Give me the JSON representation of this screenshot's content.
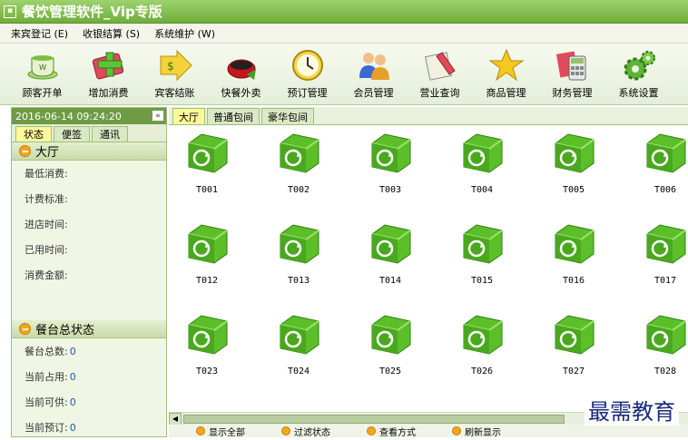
{
  "window": {
    "title": "餐饮管理软件_Vip专版"
  },
  "menu": [
    {
      "label": "来宾登记 (E)"
    },
    {
      "label": "收银结算 (S)"
    },
    {
      "label": "系统维护 (W)"
    }
  ],
  "toolbar": [
    {
      "label": "顾客开单",
      "icon": "teacup-icon"
    },
    {
      "label": "增加消费",
      "icon": "add-consumption-icon"
    },
    {
      "label": "宾客结账",
      "icon": "checkout-arrow-icon"
    },
    {
      "label": "快餐外卖",
      "icon": "takeaway-icon"
    },
    {
      "label": "预订管理",
      "icon": "clock-icon"
    },
    {
      "label": "会员管理",
      "icon": "members-icon"
    },
    {
      "label": "营业查询",
      "icon": "business-query-icon"
    },
    {
      "label": "商品管理",
      "icon": "star-icon"
    },
    {
      "label": "财务管理",
      "icon": "calculator-icon"
    },
    {
      "label": "系统设置",
      "icon": "gear-icon"
    }
  ],
  "left": {
    "datetime": "2016-06-14 09:24:20",
    "collapse": "«",
    "tabs": [
      "状态",
      "便签",
      "通讯"
    ],
    "hall_section": {
      "title": "大厅",
      "fields": [
        "最低消费:",
        "计费标准:",
        "进店时间:",
        "已用时间:",
        "消费金额:"
      ]
    },
    "status_section": {
      "title": "餐台总状态",
      "rows": [
        {
          "label": "餐台总数:",
          "value": "0"
        },
        {
          "label": "当前占用:",
          "value": "0"
        },
        {
          "label": "当前可供:",
          "value": "0"
        },
        {
          "label": "当前预订:",
          "value": "0"
        }
      ]
    }
  },
  "main": {
    "tabs": [
      "大厅",
      "普通包间",
      "豪华包间"
    ],
    "tables": [
      "T001",
      "T002",
      "T003",
      "T004",
      "T005",
      "T006",
      "T012",
      "T013",
      "T014",
      "T015",
      "T016",
      "T017",
      "T023",
      "T024",
      "T025",
      "T026",
      "T027",
      "T028"
    ],
    "bottom_buttons": [
      "显示全部",
      "过滤状态",
      "查看方式",
      "刷新显示"
    ]
  },
  "watermark": "最需教育",
  "colors": {
    "titlebar": "#7fbf45",
    "accent_green": "#66c23a",
    "active_tab": "#fff89a",
    "panel_bg": "#f0f6e4",
    "value_blue": "#1a56c0"
  }
}
